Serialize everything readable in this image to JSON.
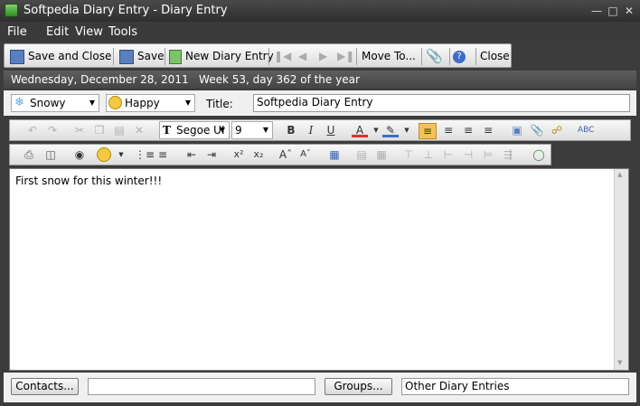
{
  "window": {
    "title": "Softpedia Diary Entry - Diary Entry"
  },
  "menu": [
    "File",
    "Edit",
    "View",
    "Tools"
  ],
  "toolbar": {
    "save_close": "Save and Close",
    "save": "Save",
    "new_entry": "New Diary Entry",
    "move_to": "Move To...",
    "close": "Close"
  },
  "date_line": "Wednesday, December 28, 2011   Week 53, day 362 of the year",
  "fields": {
    "weather": "Snowy",
    "mood": "Happy",
    "title_label": "Title:",
    "title_value": "Softpedia Diary Entry"
  },
  "format": {
    "font": "Segoe UI",
    "size": "9"
  },
  "editor": {
    "text": "First snow for this winter!!!"
  },
  "bottom": {
    "contacts": "Contacts...",
    "contacts_value": "",
    "groups": "Groups...",
    "groups_value": "Other Diary Entries"
  },
  "colors": {
    "titlebar": "#3a3a3a",
    "accent": "#f5c15c"
  }
}
